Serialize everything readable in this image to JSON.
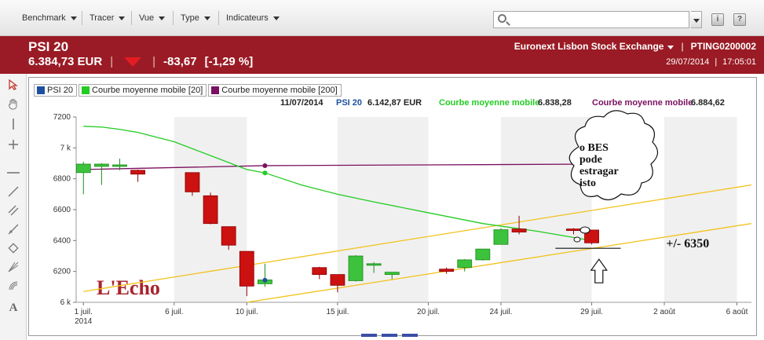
{
  "toolbar": {
    "menus": [
      "Benchmark",
      "Tracer",
      "Vue",
      "Type",
      "Indicateurs"
    ],
    "search": {
      "value": "",
      "placeholder": ""
    },
    "icons": [
      "info-icon",
      "help-icon"
    ]
  },
  "header": {
    "name": "PSI 20",
    "price": "6.384,73 EUR",
    "change": "-83,67",
    "change_pct": "[-1,29 %]",
    "exchange": "Euronext Lisbon Stock Exchange",
    "isin": "PTING0200002",
    "date": "29/07/2014",
    "time": "17:05:01",
    "trend_color": "#e31c23",
    "band_color": "#9a1b25"
  },
  "tools": [
    "cursor-arrow-icon",
    "hand-pan-icon",
    "vertical-line-icon",
    "crosshair-icon",
    "horizontal-line-icon",
    "trend-line-icon",
    "parallel-lines-icon",
    "ray-icon",
    "rectangle-icon",
    "fan-icon",
    "fibonacci-icon",
    "text-tool-icon"
  ],
  "legend": [
    {
      "label": "PSI 20",
      "color": "#1f4fa1"
    },
    {
      "label": "Courbe moyenne mobile  [20]",
      "color": "#22cc22"
    },
    {
      "label": "Courbe moyenne mobile  [200]",
      "color": "#7a1060"
    }
  ],
  "info": {
    "date": "11/07/2014",
    "psi_label": "PSI 20",
    "psi_value": "6.142,87 EUR",
    "ma20_label": "Courbe moyenne mobile",
    "ma20_value": "6.838,28",
    "ma200_label": "Courbe moyenne mobile",
    "ma200_value": "6.884,62"
  },
  "watermark": "L'Echo",
  "annotations": {
    "bubble_text": [
      "o BES",
      "pode",
      "estragar",
      "isto"
    ],
    "support_label": "+/- 6350"
  },
  "chart_data": {
    "type": "candlestick",
    "y_ticks": [
      {
        "value": 6000,
        "label": "6 k"
      },
      {
        "value": 6200,
        "label": "6200"
      },
      {
        "value": 6400,
        "label": "6400"
      },
      {
        "value": 6600,
        "label": "6600"
      },
      {
        "value": 6800,
        "label": "6800"
      },
      {
        "value": 7000,
        "label": "7 k"
      },
      {
        "value": 7200,
        "label": "7200"
      }
    ],
    "ylim": [
      6000,
      7200
    ],
    "x_ticks": [
      {
        "day": 1,
        "label": "1 juil.",
        "sub": "2014"
      },
      {
        "day": 6,
        "label": "6 juil."
      },
      {
        "day": 10,
        "label": "10 juil."
      },
      {
        "day": 15,
        "label": "15 juil."
      },
      {
        "day": 20,
        "label": "20 juil."
      },
      {
        "day": 24,
        "label": "24 juil."
      },
      {
        "day": 29,
        "label": "29 juil."
      },
      {
        "day": 33,
        "label": "2 août"
      },
      {
        "day": 37,
        "label": "6 août"
      }
    ],
    "xlim": [
      0.6,
      37.8
    ],
    "candles": [
      {
        "date": "2014-07-01",
        "open": 6840,
        "high": 6910,
        "low": 6700,
        "close": 6895
      },
      {
        "date": "2014-07-02",
        "open": 6880,
        "high": 6900,
        "low": 6760,
        "close": 6895
      },
      {
        "date": "2014-07-03",
        "open": 6885,
        "high": 6930,
        "low": 6855,
        "close": 6890
      },
      {
        "date": "2014-07-04",
        "open": 6855,
        "high": 6860,
        "low": 6780,
        "close": 6830
      },
      {
        "date": "2014-07-07",
        "open": 6840,
        "high": 6840,
        "low": 6690,
        "close": 6715
      },
      {
        "date": "2014-07-08",
        "open": 6690,
        "high": 6710,
        "low": 6505,
        "close": 6510
      },
      {
        "date": "2014-07-09",
        "open": 6490,
        "high": 6490,
        "low": 6340,
        "close": 6370
      },
      {
        "date": "2014-07-10",
        "open": 6330,
        "high": 6330,
        "low": 6040,
        "close": 6105
      },
      {
        "date": "2014-07-11",
        "open": 6120,
        "high": 6250,
        "low": 6100,
        "close": 6145
      },
      {
        "date": "2014-07-14",
        "open": 6225,
        "high": 6230,
        "low": 6150,
        "close": 6180
      },
      {
        "date": "2014-07-15",
        "open": 6180,
        "high": 6180,
        "low": 6065,
        "close": 6110
      },
      {
        "date": "2014-07-16",
        "open": 6140,
        "high": 6305,
        "low": 6135,
        "close": 6300
      },
      {
        "date": "2014-07-17",
        "open": 6250,
        "high": 6260,
        "low": 6190,
        "close": 6250
      },
      {
        "date": "2014-07-18",
        "open": 6180,
        "high": 6195,
        "low": 6150,
        "close": 6195
      },
      {
        "date": "2014-07-21",
        "open": 6215,
        "high": 6225,
        "low": 6185,
        "close": 6200
      },
      {
        "date": "2014-07-22",
        "open": 6225,
        "high": 6280,
        "low": 6200,
        "close": 6275
      },
      {
        "date": "2014-07-23",
        "open": 6275,
        "high": 6345,
        "low": 6270,
        "close": 6345
      },
      {
        "date": "2014-07-24",
        "open": 6375,
        "high": 6480,
        "low": 6375,
        "close": 6470
      },
      {
        "date": "2014-07-25",
        "open": 6475,
        "high": 6560,
        "low": 6440,
        "close": 6455
      },
      {
        "date": "2014-07-28",
        "open": 6475,
        "high": 6480,
        "low": 6440,
        "close": 6470
      },
      {
        "date": "2014-07-29",
        "open": 6468,
        "high": 6470,
        "low": 6375,
        "close": 6385
      }
    ],
    "ma20": [
      {
        "day": 1,
        "value": 7140
      },
      {
        "day": 2,
        "value": 7135
      },
      {
        "day": 3,
        "value": 7120
      },
      {
        "day": 4,
        "value": 7100
      },
      {
        "day": 6,
        "value": 7040
      },
      {
        "day": 8,
        "value": 6950
      },
      {
        "day": 10,
        "value": 6860
      },
      {
        "day": 11,
        "value": 6838
      },
      {
        "day": 13,
        "value": 6760
      },
      {
        "day": 15,
        "value": 6700
      },
      {
        "day": 17,
        "value": 6650
      },
      {
        "day": 20,
        "value": 6580
      },
      {
        "day": 23,
        "value": 6510
      },
      {
        "day": 26,
        "value": 6460
      },
      {
        "day": 29,
        "value": 6400
      }
    ],
    "ma200": [
      {
        "day": 1,
        "value": 6860
      },
      {
        "day": 11,
        "value": 6885
      },
      {
        "day": 20,
        "value": 6890
      },
      {
        "day": 29,
        "value": 6895
      }
    ],
    "trend_lines": [
      {
        "from": {
          "day": 1,
          "value": 6070
        },
        "to": {
          "day": 37.8,
          "value": 6760
        }
      },
      {
        "from": {
          "day": 10,
          "value": 6000
        },
        "to": {
          "day": 37.8,
          "value": 6510
        }
      }
    ],
    "support_level": 6350,
    "gridlines": "vertical shaded bands",
    "legend_position": "top-left"
  }
}
